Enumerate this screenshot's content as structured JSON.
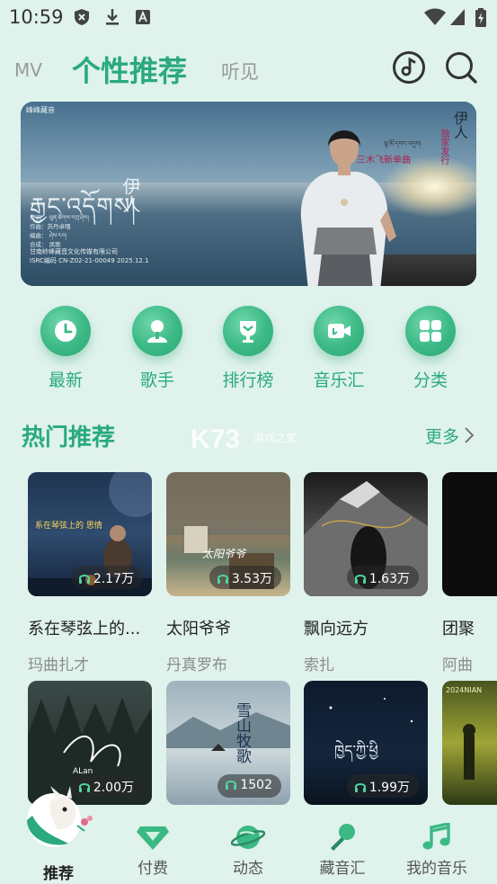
{
  "status_bar": {
    "time": "10:59"
  },
  "header": {
    "tabs": [
      {
        "label": "MV"
      },
      {
        "label": "个性推荐"
      },
      {
        "label": "听见"
      }
    ]
  },
  "banner": {
    "logo": "峰峰藏音",
    "title_tibetan": "རྒྱང་འདོགས།",
    "title_cn": "伊人",
    "song_name": "伊人",
    "exclusive": "独家发行",
    "new_single": "三木飞新单曲",
    "singer_tibetan": "ལྷ་མོ་དབང་འདུས།",
    "credits": [
      "作词：  ཕུན་ཚོགས་བཀྲ་ཤིས།",
      "作曲：苏丹卓嘎",
      "编曲：  ཤེས་རབ།",
      "合成：  凤歌"
    ],
    "company": "甘南岭峰藏音文化传媒有限公司",
    "isrc": "ISRC编码 CN-Z02-21-00049 2025.12.1"
  },
  "quick_nav": [
    {
      "label": "最新",
      "icon": "clock-icon"
    },
    {
      "label": "歌手",
      "icon": "singer-icon"
    },
    {
      "label": "排行榜",
      "icon": "trophy-icon"
    },
    {
      "label": "音乐汇",
      "icon": "video-icon"
    },
    {
      "label": "分类",
      "icon": "grid-icon"
    }
  ],
  "section": {
    "title": "热门推荐",
    "more": "更多",
    "watermark": "K73",
    "watermark_sub": "游戏之家"
  },
  "cards_row1": [
    {
      "title": "系在琴弦上的...",
      "artist": "玛曲扎才",
      "plays": "2.17万",
      "cover_text": "系在琴弦上的 思情"
    },
    {
      "title": "太阳爷爷",
      "artist": "丹真罗布",
      "plays": "3.53万",
      "cover_text": "太阳爷爷"
    },
    {
      "title": "飘向远方",
      "artist": "索扎",
      "plays": "1.63万",
      "cover_text": ""
    },
    {
      "title": "团聚",
      "artist": "阿曲",
      "plays": "",
      "cover_text": ""
    }
  ],
  "cards_row2": [
    {
      "plays": "2.00万",
      "cover_text": "ALan"
    },
    {
      "plays": "1502",
      "cover_text": "雪山牧歌"
    },
    {
      "plays": "1.99万",
      "cover_text": "ཁྱེད་ཀྱི་ཕྱི"
    },
    {
      "plays": "",
      "cover_text": "2024NIAN"
    }
  ],
  "bottom_nav": [
    {
      "label": "推荐",
      "icon": "mascot-icon"
    },
    {
      "label": "付费",
      "icon": "diamond-icon"
    },
    {
      "label": "动态",
      "icon": "planet-icon"
    },
    {
      "label": "藏音汇",
      "icon": "microphone-icon"
    },
    {
      "label": "我的音乐",
      "icon": "music-note-icon"
    }
  ],
  "colors": {
    "accent": "#2aaa7c",
    "background": "#dff2ec"
  }
}
